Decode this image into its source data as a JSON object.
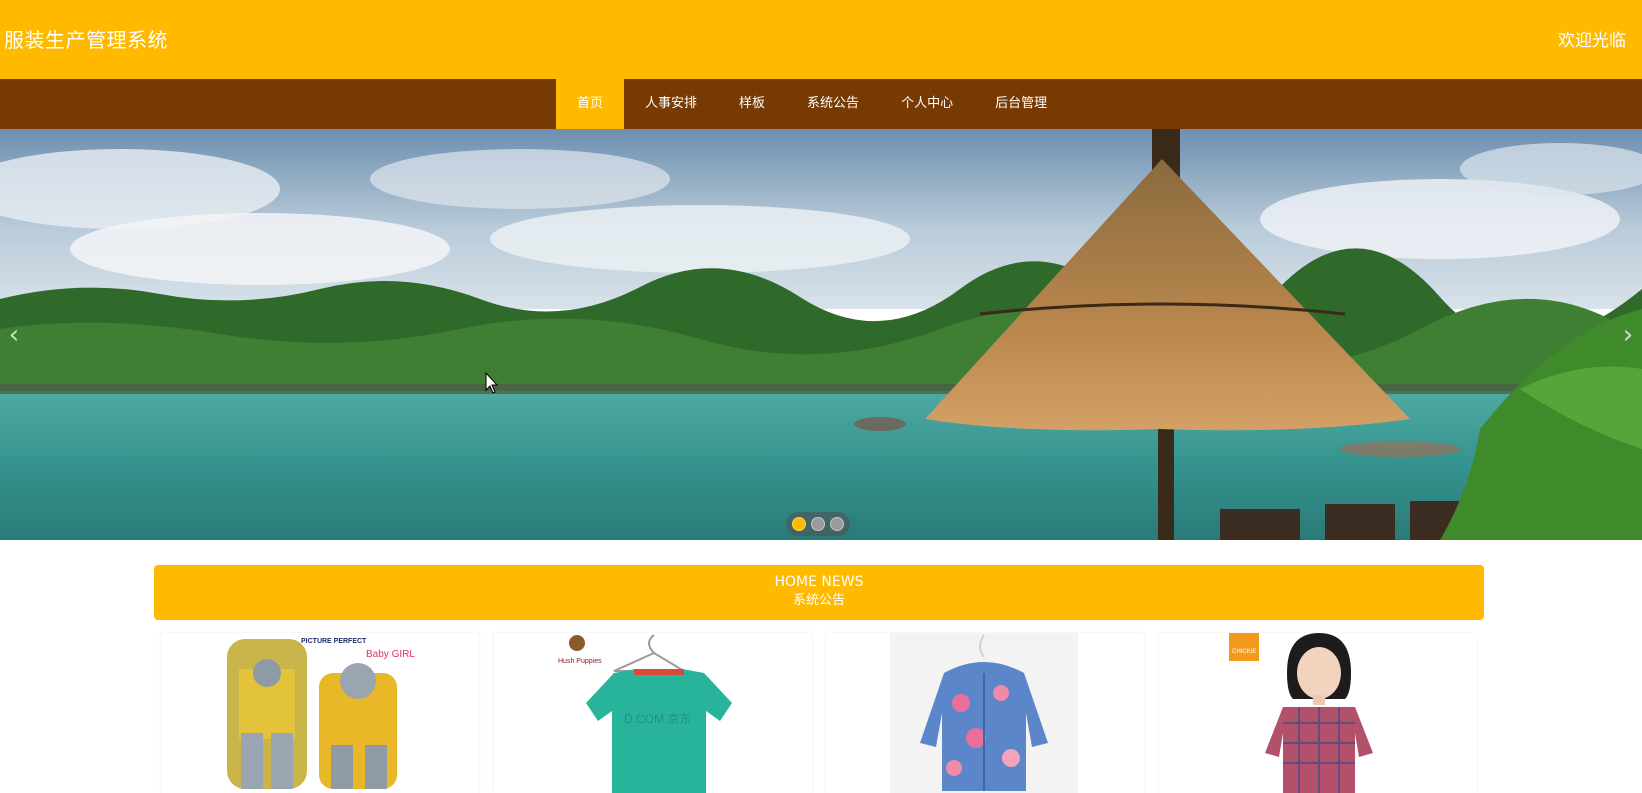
{
  "header": {
    "site_title": "服装生产管理系统",
    "welcome": "欢迎光临"
  },
  "nav": {
    "items": [
      {
        "label": "首页",
        "active": true
      },
      {
        "label": "人事安排",
        "active": false
      },
      {
        "label": "样板",
        "active": false
      },
      {
        "label": "系统公告",
        "active": false
      },
      {
        "label": "个人中心",
        "active": false
      },
      {
        "label": "后台管理",
        "active": false
      }
    ]
  },
  "carousel": {
    "slide_count": 3,
    "active_index": 0,
    "prev_icon": "chevron-left-icon",
    "next_icon": "chevron-right-icon"
  },
  "news": {
    "title_en": "HOME NEWS",
    "title_cn": "系统公告"
  },
  "products": {
    "items": [
      {
        "image": "kids-yellow-grey-outfit",
        "brand_text": "PICTURE PERFECT",
        "tag_text": "Baby GIRL"
      },
      {
        "image": "teal-tshirt-on-hanger",
        "brand_text": "Hush Puppies"
      },
      {
        "image": "floral-padded-jacket",
        "brand_text": ""
      },
      {
        "image": "girl-plaid-shirt",
        "brand_text": "CHICKIE"
      }
    ]
  },
  "colors": {
    "brand_yellow": "#FFBA00",
    "nav_brown": "#773A02",
    "text_white": "#FFFFFF"
  }
}
